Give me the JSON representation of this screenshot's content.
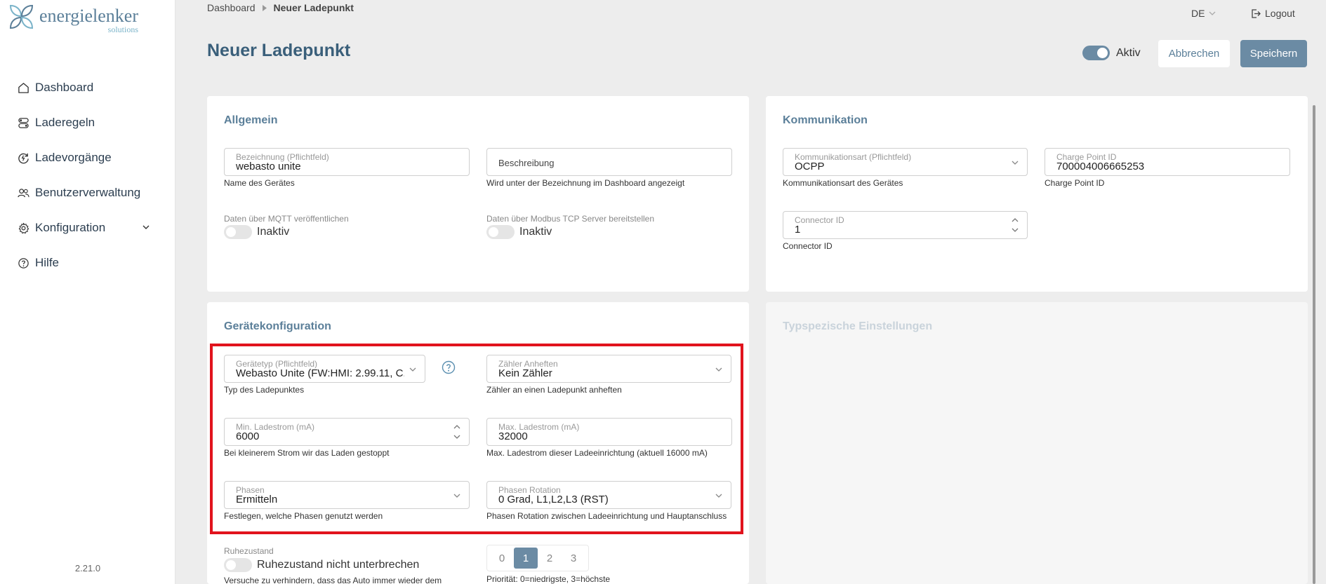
{
  "brand": {
    "name": "energielenker",
    "sub": "solutions"
  },
  "sidebar": {
    "items": [
      {
        "label": "Dashboard",
        "icon": "home-icon"
      },
      {
        "label": "Laderegeln",
        "icon": "rules-icon"
      },
      {
        "label": "Ladevorgänge",
        "icon": "charging-icon"
      },
      {
        "label": "Benutzerverwaltung",
        "icon": "users-icon"
      },
      {
        "label": "Konfiguration",
        "icon": "gear-icon"
      },
      {
        "label": "Hilfe",
        "icon": "help-icon"
      }
    ],
    "version": "2.21.0"
  },
  "header": {
    "breadcrumb": [
      "Dashboard",
      "Neuer Ladepunkt"
    ],
    "language": "DE",
    "logout": "Logout",
    "title": "Neuer Ladepunkt",
    "active_label": "Aktiv",
    "active": true,
    "cancel": "Abbrechen",
    "save": "Speichern"
  },
  "allgemein": {
    "title": "Allgemein",
    "bezeichnung": {
      "label": "Bezeichnung (Pflichtfeld)",
      "value": "webasto unite",
      "hint": "Name des Gerätes"
    },
    "beschreibung": {
      "placeholder": "Beschreibung",
      "hint": "Wird unter der Bezeichnung im Dashboard angezeigt"
    },
    "mqtt": {
      "label": "Daten über MQTT veröffentlichen",
      "state": "Inaktiv"
    },
    "modbus": {
      "label": "Daten über Modbus TCP Server bereitstellen",
      "state": "Inaktiv"
    }
  },
  "kommunikation": {
    "title": "Kommunikation",
    "art": {
      "label": "Kommunikationsart (Pflichtfeld)",
      "value": "OCPP",
      "hint": "Kommunikationsart des Gerätes"
    },
    "cpid": {
      "label": "Charge Point ID",
      "value": "700004006665253",
      "hint": "Charge Point ID"
    },
    "connector": {
      "label": "Connector ID",
      "value": "1",
      "hint": "Connector ID"
    }
  },
  "geraet": {
    "title": "Gerätekonfiguration",
    "typ": {
      "label": "Gerätetyp (Pflichtfeld)",
      "value": "Webasto Unite (FW:HMI: 2.99.11, C...",
      "hint": "Typ des Ladepunktes"
    },
    "zaehler": {
      "label": "Zähler Anheften",
      "value": "Kein Zähler",
      "hint": "Zähler an einen Ladepunkt anheften"
    },
    "min": {
      "label": "Min. Ladestrom (mA)",
      "value": "6000",
      "hint": "Bei kleinerem Strom wir das Laden gestoppt"
    },
    "max": {
      "label": "Max. Ladestrom (mA)",
      "value": "32000",
      "hint": "Max. Ladestrom dieser Ladeeinrichtung (aktuell 16000 mA)"
    },
    "phasen": {
      "label": "Phasen",
      "value": "Ermitteln",
      "hint": "Festlegen, welche Phasen genutzt werden"
    },
    "rotation": {
      "label": "Phasen Rotation",
      "value": "0 Grad, L1,L2,L3 (RST)",
      "hint": "Phasen Rotation zwischen Ladeeinrichtung und Hauptanschluss"
    },
    "ruhe": {
      "label": "Ruhezustand",
      "toggle_label": "Ruhezustand nicht unterbrechen",
      "hint": "Versuche zu verhindern, dass das Auto immer wieder dem"
    },
    "prio": {
      "options": [
        "0",
        "1",
        "2",
        "3"
      ],
      "selected": "1",
      "hint": "Priorität: 0=niedrigste, 3=höchste"
    }
  },
  "typ_einstellungen": {
    "title": "Typspezische Einstellungen"
  },
  "colors": {
    "accent": "#6b8ba4",
    "title": "#3a5f7a",
    "highlight": "#e1131d"
  }
}
